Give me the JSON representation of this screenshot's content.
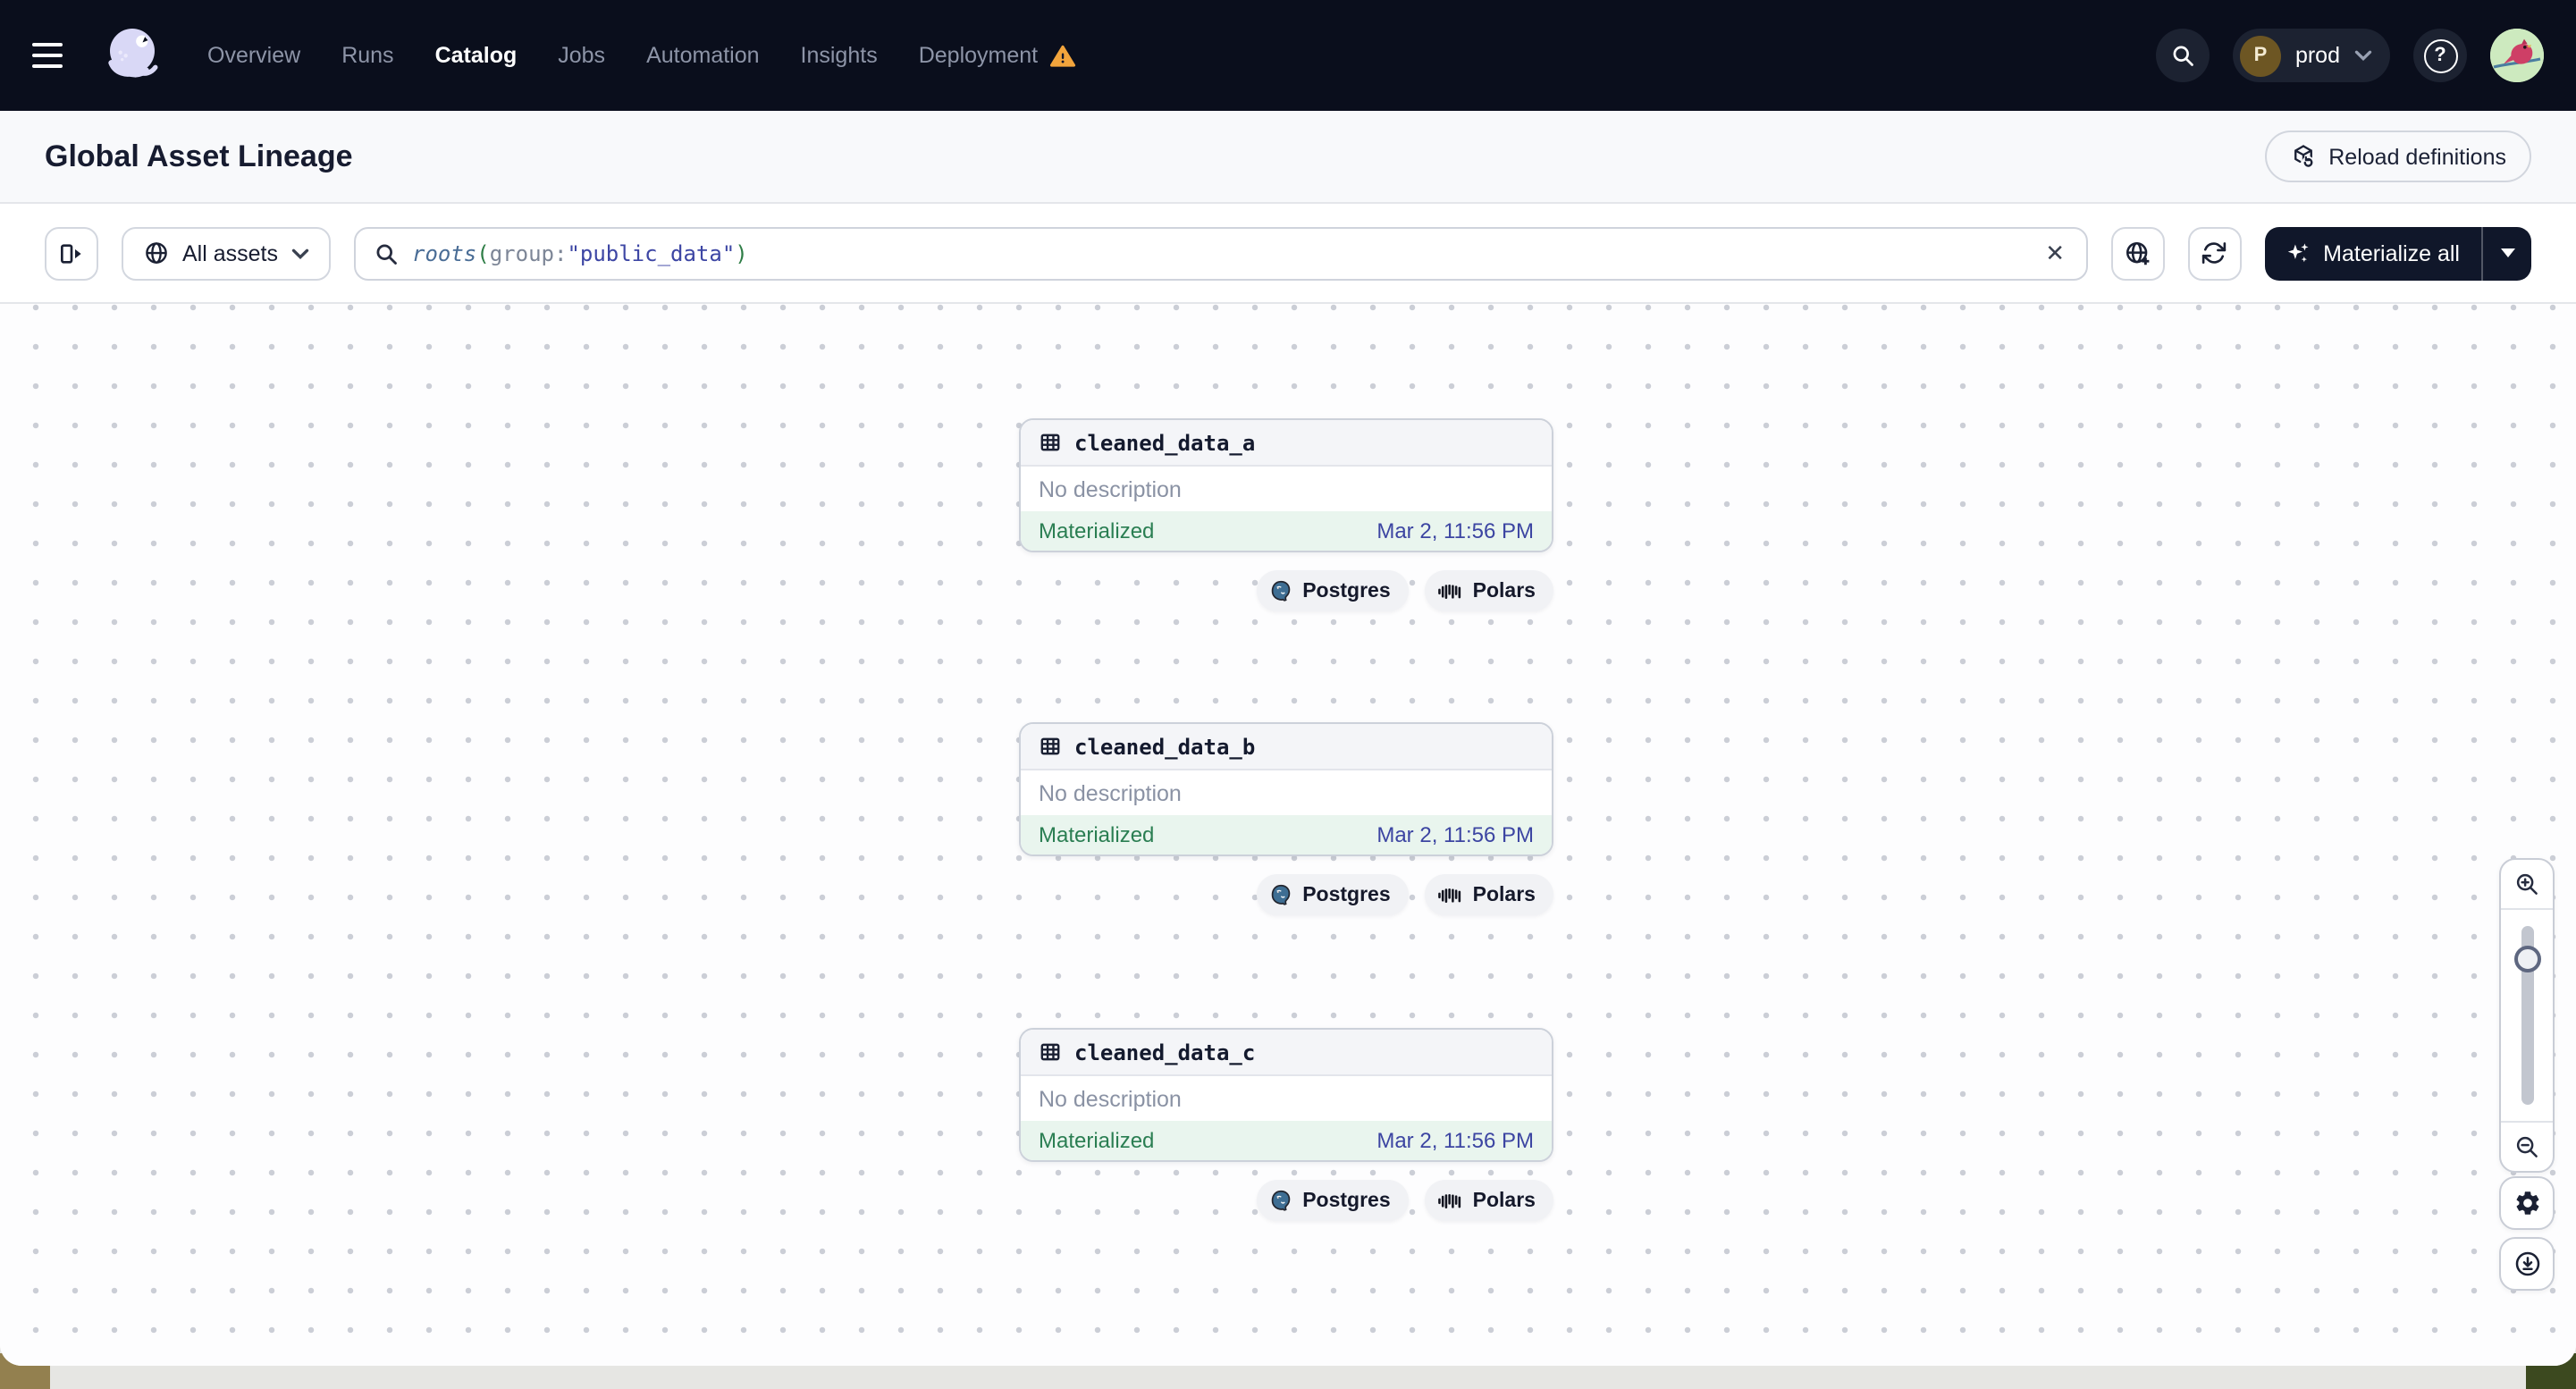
{
  "nav": {
    "items": [
      {
        "label": "Overview"
      },
      {
        "label": "Runs"
      },
      {
        "label": "Catalog",
        "active": true
      },
      {
        "label": "Jobs"
      },
      {
        "label": "Automation"
      },
      {
        "label": "Insights"
      },
      {
        "label": "Deployment",
        "warning": true
      }
    ],
    "environment": {
      "initial": "P",
      "label": "prod"
    },
    "help_glyph": "?"
  },
  "header": {
    "title": "Global Asset Lineage",
    "reload_button_label": "Reload definitions"
  },
  "toolbar": {
    "assets_filter_label": "All assets",
    "materialize_button_label": "Materialize all",
    "clear_glyph": "✕",
    "search": {
      "segments": [
        {
          "text": "roots",
          "type": "function"
        },
        {
          "text": "(",
          "type": "paren"
        },
        {
          "text": "group:",
          "type": "key"
        },
        {
          "text": "\"public_data\"",
          "type": "string"
        },
        {
          "text": ")",
          "type": "paren"
        }
      ]
    }
  },
  "graph": {
    "nodes": [
      {
        "name": "cleaned_data_a",
        "description": "No description",
        "status": "Materialized",
        "timestamp": "Mar 2, 11:56 PM",
        "tags": [
          {
            "label": "Postgres"
          },
          {
            "label": "Polars"
          }
        ]
      },
      {
        "name": "cleaned_data_b",
        "description": "No description",
        "status": "Materialized",
        "timestamp": "Mar 2, 11:56 PM",
        "tags": [
          {
            "label": "Postgres"
          },
          {
            "label": "Polars"
          }
        ]
      },
      {
        "name": "cleaned_data_c",
        "description": "No description",
        "status": "Materialized",
        "timestamp": "Mar 2, 11:56 PM",
        "tags": [
          {
            "label": "Postgres"
          },
          {
            "label": "Polars"
          }
        ]
      }
    ]
  },
  "icons": [
    "hamburger-menu",
    "dagster-logo",
    "warning-triangle",
    "search",
    "help",
    "user-avatar",
    "panel-expand",
    "globe",
    "globe-add",
    "refresh",
    "sparkles",
    "clear-x",
    "table-grid",
    "postgres-logo",
    "polars-logo",
    "zoom-in",
    "zoom-out",
    "settings-gear",
    "download",
    "chevron-down",
    "cube-reload"
  ],
  "colors": {
    "nav_bg": "#0a0e1c",
    "dark_button_bg": "#10172a",
    "status_bg": "#e9f5ee",
    "status_text": "#2a7e52",
    "timestamp_text": "#3c45a2",
    "warning": "#f2a43c",
    "query_function": "#4a6d96",
    "query_paren": "#2e7d46",
    "query_key": "#7d8697",
    "query_string": "#3d46a4"
  }
}
